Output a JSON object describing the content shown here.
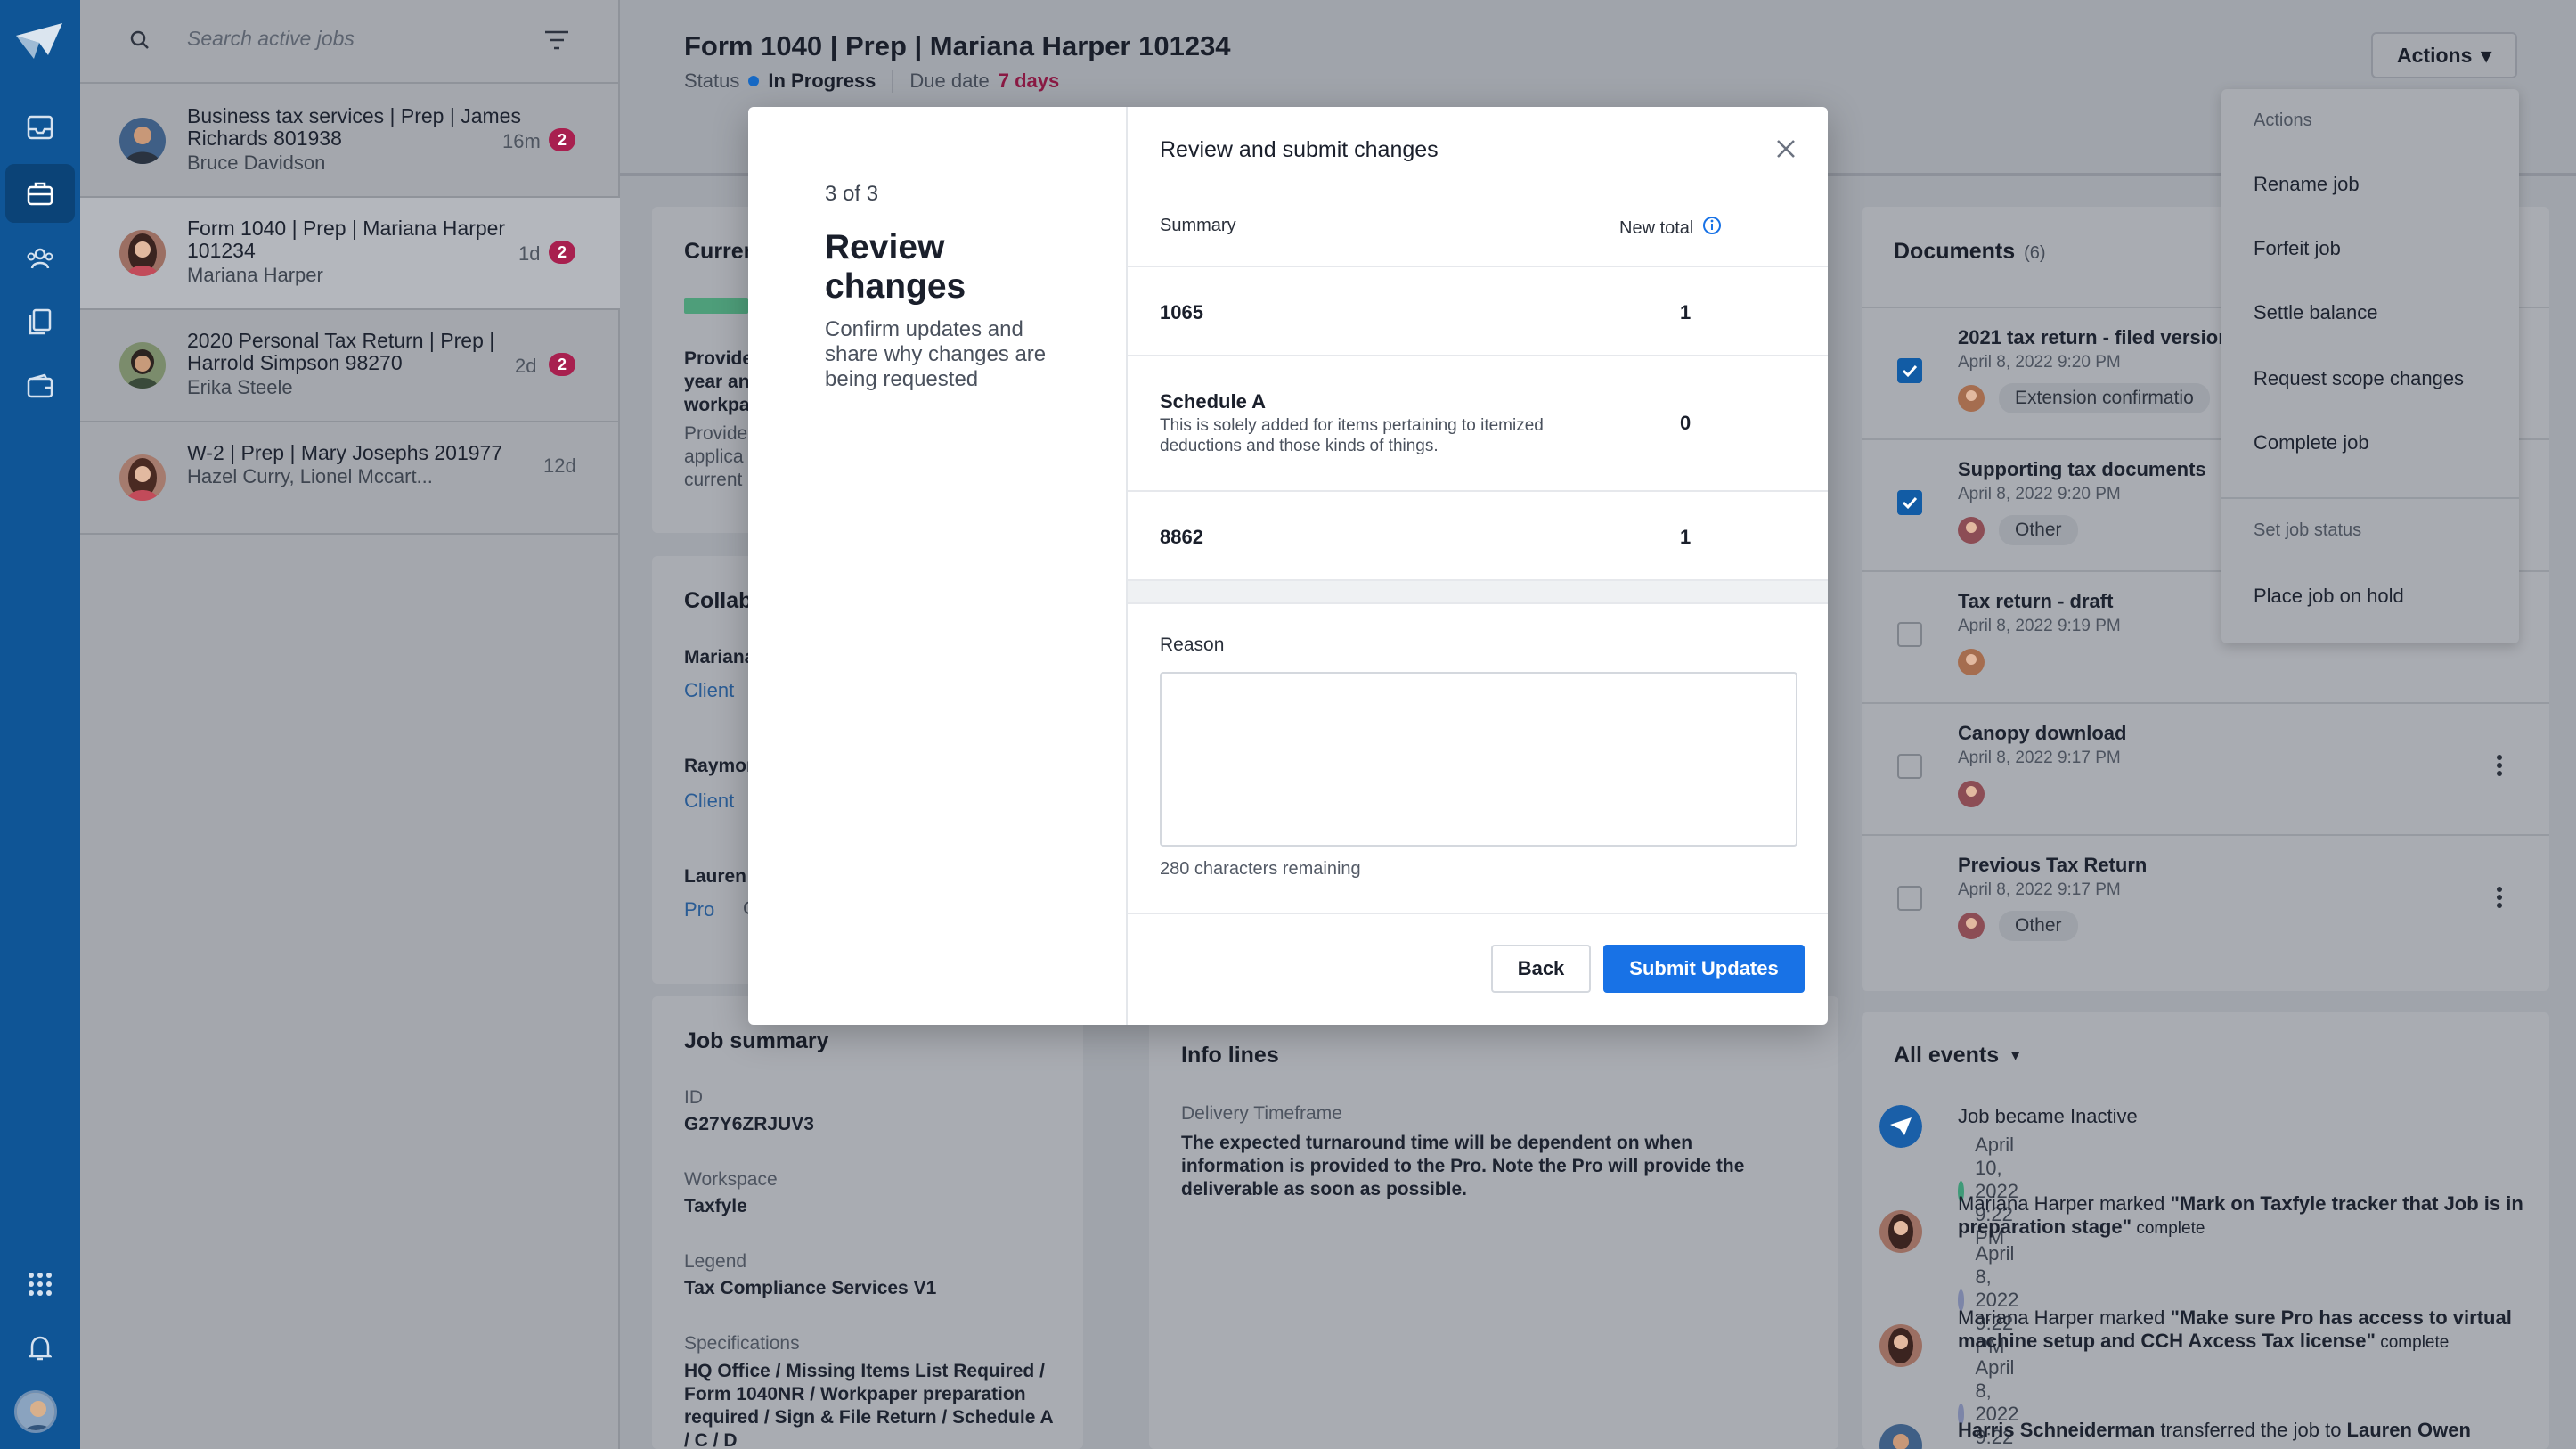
{
  "app": {
    "search_placeholder": "Search active jobs",
    "colors": {
      "brand": "#0f5596",
      "accent": "#1872e6",
      "badge": "#a8204f",
      "due": "#8a1a44"
    }
  },
  "jobs": [
    {
      "title": "Business tax services | Prep | James Richards 801938",
      "client": "Bruce Davidson",
      "age": "16m",
      "badge": "2"
    },
    {
      "title": "Form 1040 | Prep | Mariana Harper 101234",
      "client": "Mariana Harper",
      "age": "1d",
      "badge": "2"
    },
    {
      "title": "2020 Personal Tax Return | Prep | Harrold Simpson 98270",
      "client": "Erika Steele",
      "age": "2d",
      "badge": "2"
    },
    {
      "title": "W-2 | Prep | Mary Josephs 201977",
      "client": "Hazel Curry, Lionel Mccart...",
      "age": "12d",
      "badge": ""
    }
  ],
  "header": {
    "title": "Form 1040 | Prep | Mariana Harper 101234",
    "status_label": "Status",
    "status_value": "In Progress",
    "due_label": "Due date",
    "due_value": "7 days",
    "actions_label": "Actions"
  },
  "current": {
    "title": "Curren",
    "line1": "Provide",
    "line2": "year an",
    "line3": "workpa",
    "line4": "Provide",
    "line5": "applica",
    "line6": "current"
  },
  "collaborators": {
    "title": "Collab",
    "people": [
      {
        "name": "Mariana",
        "role": "Client"
      },
      {
        "name": "Raymon",
        "role": "Client"
      },
      {
        "name": "Lauren",
        "role": "Pro",
        "extra": "C"
      }
    ]
  },
  "job_summary": {
    "title": "Job summary",
    "fields": [
      {
        "label": "ID",
        "value": "G27Y6ZRJUV3"
      },
      {
        "label": "Workspace",
        "value": "Taxfyle"
      },
      {
        "label": "Legend",
        "value": "Tax Compliance Services V1"
      },
      {
        "label": "Specifications",
        "value": "HQ Office / Missing Items List Required / Form 1040NR / Workpaper preparation required / Sign & File Return / Schedule A / C / D"
      }
    ]
  },
  "info_lines": {
    "title": "Info lines",
    "label": "Delivery Timeframe",
    "value": "The expected turnaround time will be dependent on when information is provided to the Pro. Note the Pro will provide the deliverable as soon as possible."
  },
  "documents": {
    "title": "Documents",
    "count": "(6)",
    "items": [
      {
        "name": "2021 tax return - filed version",
        "date": "April 8, 2022 9:20 PM",
        "tag": "Extension confirmatio",
        "checked": true
      },
      {
        "name": "Supporting tax documents",
        "date": "April 8, 2022 9:20 PM",
        "tag": "Other",
        "checked": true
      },
      {
        "name": "Tax return - draft",
        "date": "April 8, 2022 9:19 PM",
        "tag": "",
        "checked": false
      },
      {
        "name": "Canopy download",
        "date": "April 8, 2022 9:17 PM",
        "tag": "",
        "checked": false
      },
      {
        "name": "Previous Tax Return",
        "date": "April 8, 2022 9:17 PM",
        "tag": "Other",
        "checked": false
      }
    ]
  },
  "events": {
    "title": "All events",
    "items": [
      {
        "text": "Job became Inactive",
        "meta": "April 10, 2022 9:22 PM"
      },
      {
        "actor": "Mariana Harper",
        "verb": " marked ",
        "quote": "\"Mark on Taxfyle tracker that Job is in preparation stage\"",
        "tail": " complete",
        "meta": "April 8, 2022 9:22 PM"
      },
      {
        "actor": "Mariana Harper",
        "verb": " marked ",
        "quote": "\"Make sure Pro has access to virtual machine setup and CCH Axcess Tax license\"",
        "tail": " complete",
        "meta": "April 8, 2022 9:22 PM"
      },
      {
        "actor": "Harris Schneiderman",
        "verb": " transferred the job to ",
        "quote": "Lauren Owen",
        "tail": "",
        "meta": ""
      }
    ]
  },
  "actions_menu": {
    "header": "Actions",
    "items": [
      "Rename job",
      "Forfeit job",
      "Settle balance",
      "Request scope changes",
      "Complete job"
    ],
    "status_header": "Set job status",
    "status_items": [
      "Place job on hold"
    ]
  },
  "modal": {
    "step": "3 of 3",
    "heading": "Review changes",
    "description": "Confirm updates and share why changes are being requested",
    "title": "Review and submit changes",
    "summary_label": "Summary",
    "new_total_label": "New total",
    "rows": [
      {
        "name": "1065",
        "desc": "",
        "total": "1"
      },
      {
        "name": "Schedule A",
        "desc": "This is solely added for items pertaining to itemized deductions and those kinds of things.",
        "total": "0"
      },
      {
        "name": "8862",
        "desc": "",
        "total": "1"
      }
    ],
    "reason_label": "Reason",
    "reason_value": "",
    "remaining": "280 characters remaining",
    "back_label": "Back",
    "submit_label": "Submit Updates"
  }
}
